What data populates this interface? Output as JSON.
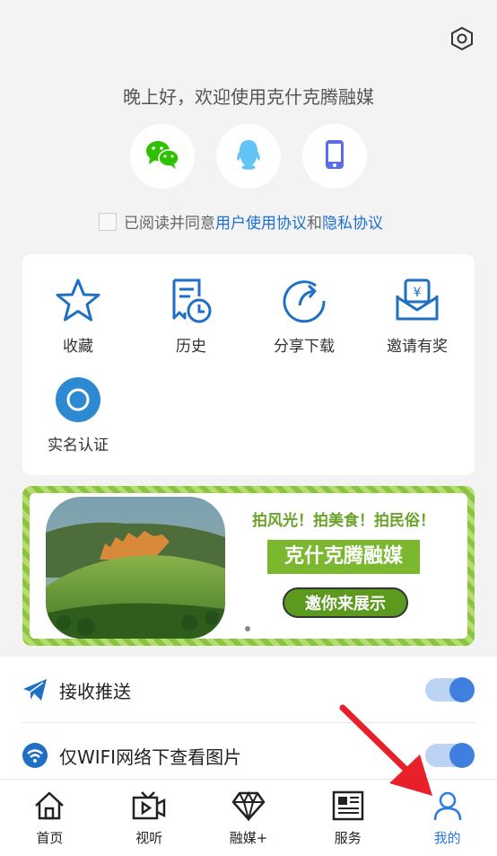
{
  "header": {
    "settings_icon": "hexagon-gear-icon",
    "greeting": "晚上好，欢迎使用克什克腾融媒"
  },
  "login": {
    "methods": [
      {
        "name": "wechat",
        "icon": "wechat-icon",
        "color": "#2dc100"
      },
      {
        "name": "qq",
        "icon": "qq-icon",
        "color": "#62c3f5"
      },
      {
        "name": "phone",
        "icon": "phone-icon",
        "color": "#5b6de3"
      }
    ]
  },
  "agreement": {
    "prefix": "已阅读并同意",
    "terms": "用户使用协议",
    "and": "和",
    "privacy": "隐私协议"
  },
  "shortcuts": {
    "items": [
      {
        "label": "收藏",
        "icon": "star-icon"
      },
      {
        "label": "历史",
        "icon": "history-icon"
      },
      {
        "label": "分享下载",
        "icon": "share-icon"
      },
      {
        "label": "邀请有奖",
        "icon": "reward-envelope-icon"
      },
      {
        "label": "实名认证",
        "icon": "verify-icon"
      }
    ]
  },
  "banner": {
    "slogan": "拍风光！拍美食！拍民俗！",
    "title": "克什克腾融媒",
    "button": "邀你来展示"
  },
  "settings": {
    "push_label": "接收推送",
    "push_on": true,
    "wifi_label": "仅WIFI网络下查看图片",
    "wifi_on": true
  },
  "tabbar": {
    "tabs": [
      {
        "label": "首页",
        "icon": "home-icon"
      },
      {
        "label": "视听",
        "icon": "tv-icon"
      },
      {
        "label": "融媒+",
        "icon": "diamond-icon"
      },
      {
        "label": "服务",
        "icon": "newspaper-icon"
      },
      {
        "label": "我的",
        "icon": "user-icon",
        "active": true
      }
    ]
  },
  "colors": {
    "accent": "#2b7be0",
    "icon_blue": "#1f6fc5",
    "banner_green": "#7cb82f",
    "annotation_arrow": "#e8202a"
  }
}
